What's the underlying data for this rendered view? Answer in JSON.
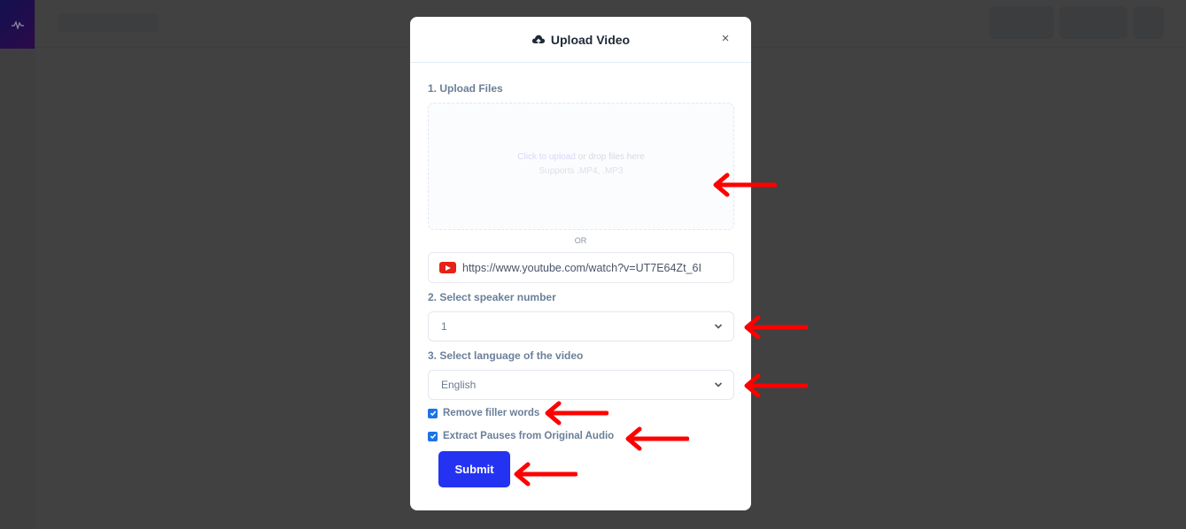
{
  "background": {
    "logo_icon": "waveform-icon"
  },
  "modal": {
    "title": "Upload Video",
    "title_icon": "cloud-upload-icon",
    "close_icon": "close-icon",
    "close_glyph": "×",
    "step1_label": "1. Upload Files",
    "dropzone": {
      "link_text": "Click to upload",
      "rest_text": " or drop files here",
      "supports_text": "Supports .MP4, .MP3"
    },
    "or_text": "OR",
    "youtube_url": {
      "icon": "youtube-icon",
      "value": "https://www.youtube.com/watch?v=UT7E64Zt_6I"
    },
    "step2_label": "2. Select speaker number",
    "speaker_select": {
      "value": "1"
    },
    "step3_label": "3. Select language of the video",
    "language_select": {
      "value": "English"
    },
    "checkboxes": [
      {
        "label": "Remove filler words",
        "checked": true
      },
      {
        "label": "Extract Pauses from Original Audio",
        "checked": true
      }
    ],
    "submit_label": "Submit"
  },
  "annotations": {
    "arrow_color": "#ff0000",
    "arrows": [
      "dropzone",
      "speaker-select",
      "language-select",
      "remove-filler",
      "extract-pauses",
      "submit"
    ]
  },
  "colors": {
    "accent": "#2433f2",
    "overlay": "#414141",
    "label": "#6b7f99"
  }
}
